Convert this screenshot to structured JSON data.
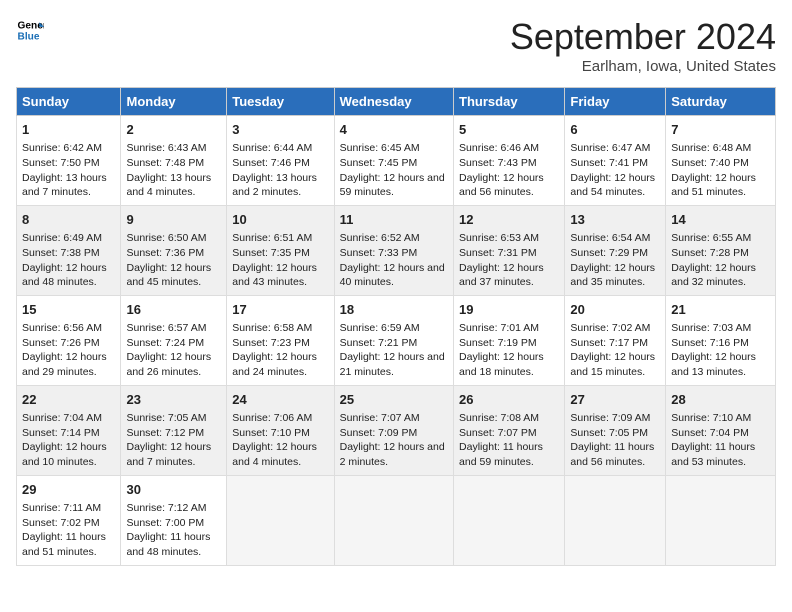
{
  "header": {
    "logo_line1": "General",
    "logo_line2": "Blue",
    "title": "September 2024",
    "subtitle": "Earlham, Iowa, United States"
  },
  "days_of_week": [
    "Sunday",
    "Monday",
    "Tuesday",
    "Wednesday",
    "Thursday",
    "Friday",
    "Saturday"
  ],
  "weeks": [
    [
      {
        "day": 1,
        "sunrise": "6:42 AM",
        "sunset": "7:50 PM",
        "daylight": "13 hours and 7 minutes."
      },
      {
        "day": 2,
        "sunrise": "6:43 AM",
        "sunset": "7:48 PM",
        "daylight": "13 hours and 4 minutes."
      },
      {
        "day": 3,
        "sunrise": "6:44 AM",
        "sunset": "7:46 PM",
        "daylight": "13 hours and 2 minutes."
      },
      {
        "day": 4,
        "sunrise": "6:45 AM",
        "sunset": "7:45 PM",
        "daylight": "12 hours and 59 minutes."
      },
      {
        "day": 5,
        "sunrise": "6:46 AM",
        "sunset": "7:43 PM",
        "daylight": "12 hours and 56 minutes."
      },
      {
        "day": 6,
        "sunrise": "6:47 AM",
        "sunset": "7:41 PM",
        "daylight": "12 hours and 54 minutes."
      },
      {
        "day": 7,
        "sunrise": "6:48 AM",
        "sunset": "7:40 PM",
        "daylight": "12 hours and 51 minutes."
      }
    ],
    [
      {
        "day": 8,
        "sunrise": "6:49 AM",
        "sunset": "7:38 PM",
        "daylight": "12 hours and 48 minutes."
      },
      {
        "day": 9,
        "sunrise": "6:50 AM",
        "sunset": "7:36 PM",
        "daylight": "12 hours and 45 minutes."
      },
      {
        "day": 10,
        "sunrise": "6:51 AM",
        "sunset": "7:35 PM",
        "daylight": "12 hours and 43 minutes."
      },
      {
        "day": 11,
        "sunrise": "6:52 AM",
        "sunset": "7:33 PM",
        "daylight": "12 hours and 40 minutes."
      },
      {
        "day": 12,
        "sunrise": "6:53 AM",
        "sunset": "7:31 PM",
        "daylight": "12 hours and 37 minutes."
      },
      {
        "day": 13,
        "sunrise": "6:54 AM",
        "sunset": "7:29 PM",
        "daylight": "12 hours and 35 minutes."
      },
      {
        "day": 14,
        "sunrise": "6:55 AM",
        "sunset": "7:28 PM",
        "daylight": "12 hours and 32 minutes."
      }
    ],
    [
      {
        "day": 15,
        "sunrise": "6:56 AM",
        "sunset": "7:26 PM",
        "daylight": "12 hours and 29 minutes."
      },
      {
        "day": 16,
        "sunrise": "6:57 AM",
        "sunset": "7:24 PM",
        "daylight": "12 hours and 26 minutes."
      },
      {
        "day": 17,
        "sunrise": "6:58 AM",
        "sunset": "7:23 PM",
        "daylight": "12 hours and 24 minutes."
      },
      {
        "day": 18,
        "sunrise": "6:59 AM",
        "sunset": "7:21 PM",
        "daylight": "12 hours and 21 minutes."
      },
      {
        "day": 19,
        "sunrise": "7:01 AM",
        "sunset": "7:19 PM",
        "daylight": "12 hours and 18 minutes."
      },
      {
        "day": 20,
        "sunrise": "7:02 AM",
        "sunset": "7:17 PM",
        "daylight": "12 hours and 15 minutes."
      },
      {
        "day": 21,
        "sunrise": "7:03 AM",
        "sunset": "7:16 PM",
        "daylight": "12 hours and 13 minutes."
      }
    ],
    [
      {
        "day": 22,
        "sunrise": "7:04 AM",
        "sunset": "7:14 PM",
        "daylight": "12 hours and 10 minutes."
      },
      {
        "day": 23,
        "sunrise": "7:05 AM",
        "sunset": "7:12 PM",
        "daylight": "12 hours and 7 minutes."
      },
      {
        "day": 24,
        "sunrise": "7:06 AM",
        "sunset": "7:10 PM",
        "daylight": "12 hours and 4 minutes."
      },
      {
        "day": 25,
        "sunrise": "7:07 AM",
        "sunset": "7:09 PM",
        "daylight": "12 hours and 2 minutes."
      },
      {
        "day": 26,
        "sunrise": "7:08 AM",
        "sunset": "7:07 PM",
        "daylight": "11 hours and 59 minutes."
      },
      {
        "day": 27,
        "sunrise": "7:09 AM",
        "sunset": "7:05 PM",
        "daylight": "11 hours and 56 minutes."
      },
      {
        "day": 28,
        "sunrise": "7:10 AM",
        "sunset": "7:04 PM",
        "daylight": "11 hours and 53 minutes."
      }
    ],
    [
      {
        "day": 29,
        "sunrise": "7:11 AM",
        "sunset": "7:02 PM",
        "daylight": "11 hours and 51 minutes."
      },
      {
        "day": 30,
        "sunrise": "7:12 AM",
        "sunset": "7:00 PM",
        "daylight": "11 hours and 48 minutes."
      },
      null,
      null,
      null,
      null,
      null
    ]
  ]
}
